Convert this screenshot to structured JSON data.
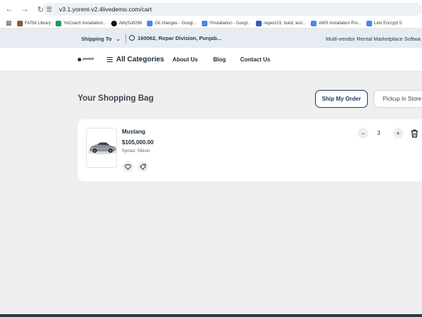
{
  "browser": {
    "url": "v3.1.yorent-v2.4livedemo.com/cart",
    "bookmarks": [
      {
        "label": "FATbit Library",
        "color": "#8b5a2b"
      },
      {
        "label": "YoCoach Installation...",
        "color": "#1a9e5c"
      },
      {
        "label": "AblySoft268",
        "color": "#111111"
      },
      {
        "label": "Git changes - Googl...",
        "color": "#4a86e8"
      },
      {
        "label": "!!Installation - Googl...",
        "color": "#4a86e8"
      },
      {
        "label": "regex101: build, test...",
        "color": "#3a5bb8"
      },
      {
        "label": "AWS Installation Pro...",
        "color": "#4a86e8"
      },
      {
        "label": "Lets Encrypt S",
        "color": "#4a86e8"
      }
    ]
  },
  "topbar": {
    "shipping_label": "Shipping To",
    "location": "160062, Ropar Division, Punjab...",
    "tagline": "Multi-vendor Rental Marketplace Softwa"
  },
  "header": {
    "logo_text": "yorent",
    "categories_label": "All Categories",
    "nav": [
      "About Us",
      "Blog",
      "Contact Us"
    ]
  },
  "main": {
    "title": "Your Shopping Bag",
    "ship_button": "Ship My Order",
    "pickup_button": "Pickup In Store"
  },
  "cart": {
    "items": [
      {
        "name": "Mustang",
        "price": "$105,000.00",
        "variant": "Syntax: Silicon",
        "quantity": "3",
        "image_icon": "car-image"
      }
    ]
  },
  "colors": {
    "accent": "#1e3a5c",
    "page_bg": "#efefef",
    "strip_bg": "#e6ecf1"
  }
}
